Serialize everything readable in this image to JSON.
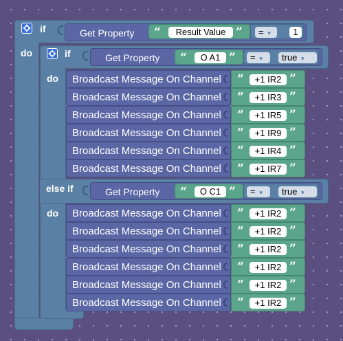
{
  "outer_if": {
    "if_label": "if",
    "do_label": "do",
    "condition": {
      "get_property_label": "Get Property",
      "property_name": "Result Value",
      "operator": "=",
      "value": "1"
    }
  },
  "inner_if": {
    "if_label": "if",
    "do_label": "do",
    "else_if_label": "else if",
    "condition1": {
      "get_property_label": "Get Property",
      "property_name": "O A1",
      "operator": "=",
      "value": "true"
    },
    "condition2": {
      "get_property_label": "Get Property",
      "property_name": "O C1",
      "operator": "=",
      "value": "true"
    }
  },
  "broadcast_label": "Broadcast Message On Channel",
  "quote_open": "“",
  "quote_close": "”",
  "do_branch_messages": [
    "+1 IR2",
    "+1 IR3",
    "+1 IR5",
    "+1 IR9",
    "+1 IR4",
    "+1 IR7"
  ],
  "else_if_branch_messages": [
    "+1 IR2",
    "+1 IR2",
    "+1 IR2",
    "+1 IR2",
    "+1 IR2",
    "+1 IR2"
  ],
  "colors": {
    "control": "#5b80a5",
    "procedure": "#5b67a5",
    "text": "#5ba58c",
    "workspace": "#5b4f7f"
  }
}
